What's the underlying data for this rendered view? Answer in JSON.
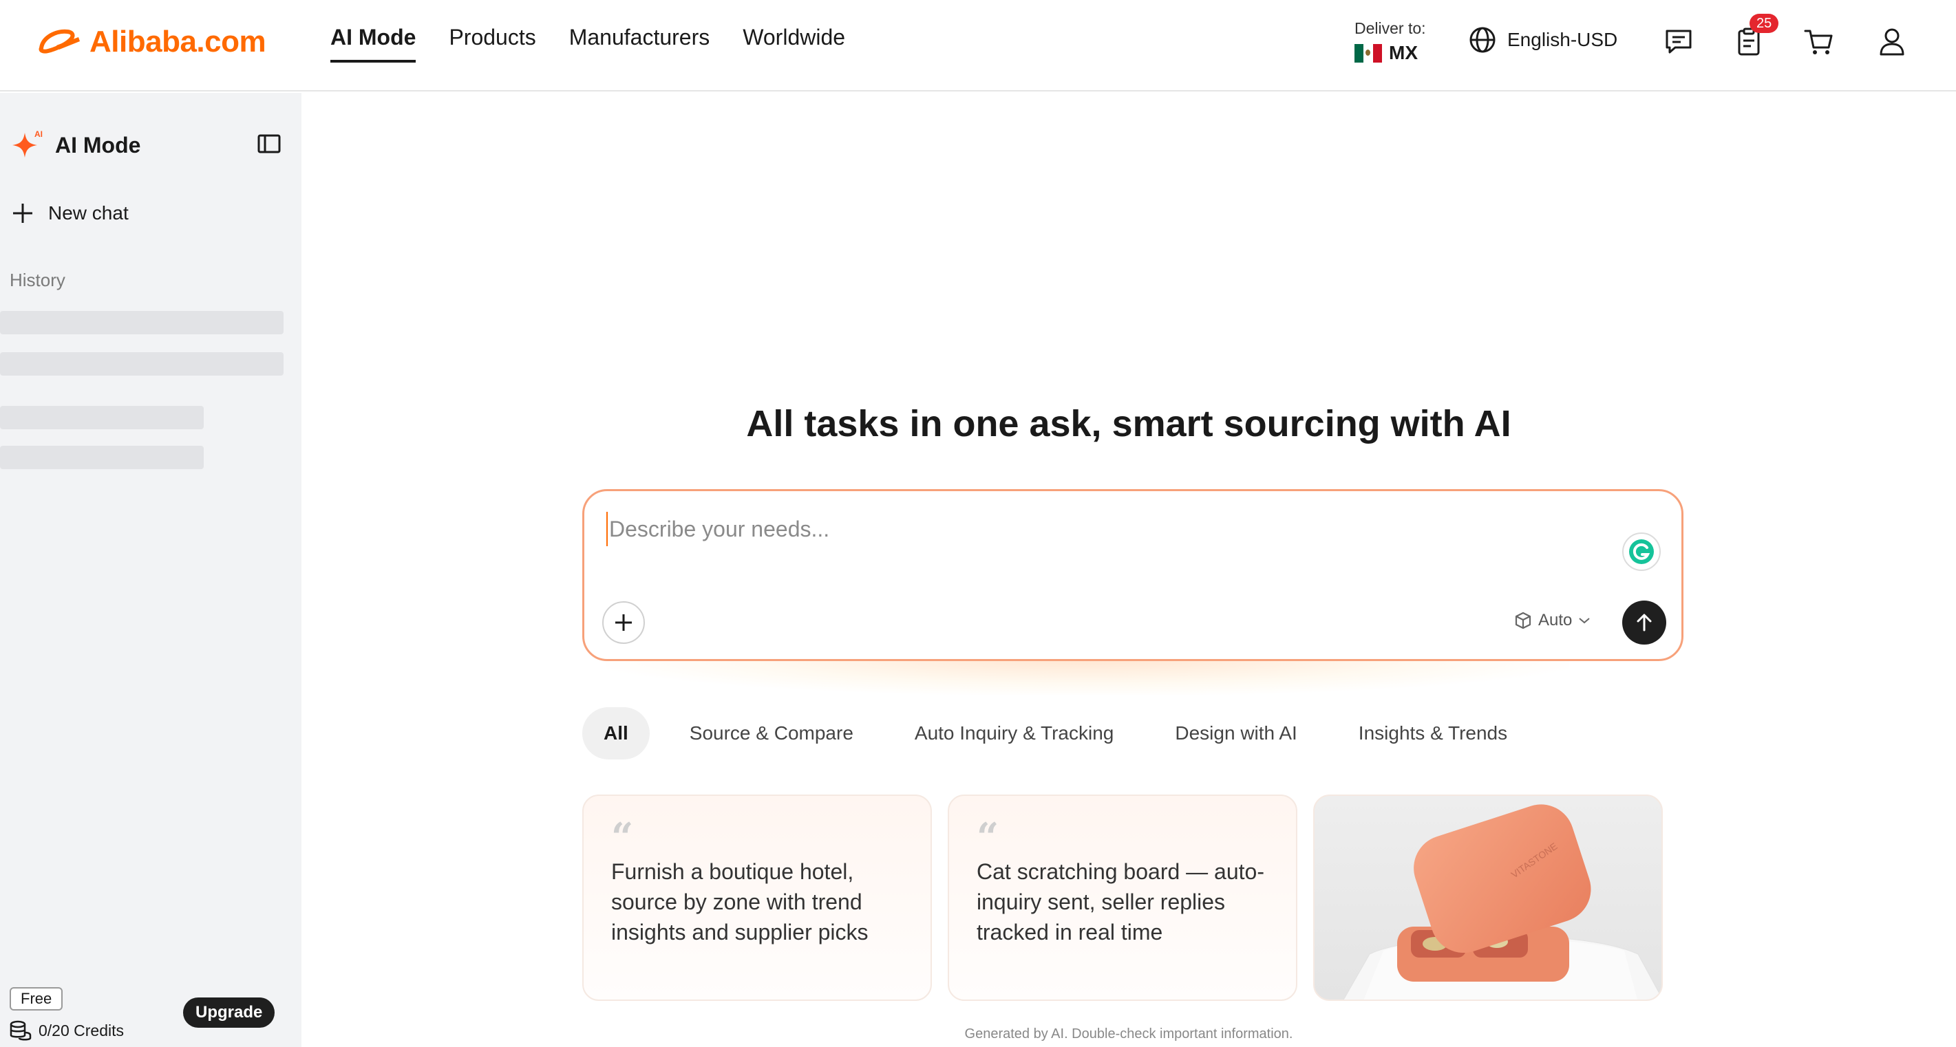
{
  "header": {
    "logo_text": "Alibaba.com",
    "nav": [
      {
        "label": "AI Mode",
        "active": true
      },
      {
        "label": "Products",
        "active": false
      },
      {
        "label": "Manufacturers",
        "active": false
      },
      {
        "label": "Worldwide",
        "active": false
      }
    ],
    "deliver_label": "Deliver to:",
    "deliver_country": "MX",
    "language": "English-USD",
    "orders_badge": "25",
    "icons": [
      "globe-icon",
      "message-icon",
      "orders-icon",
      "cart-icon",
      "user-icon"
    ]
  },
  "sidebar": {
    "title": "AI Mode",
    "title_badge": "AI",
    "new_chat": "New chat",
    "history_label": "History",
    "plan": "Free",
    "credits": "0/20 Credits",
    "upgrade": "Upgrade"
  },
  "main": {
    "headline": "All tasks in one ask, smart sourcing with AI",
    "prompt_placeholder": "Describe your needs...",
    "model_label": "Auto",
    "tabs": [
      "All",
      "Source & Compare",
      "Auto Inquiry & Tracking",
      "Design with AI",
      "Insights & Trends"
    ],
    "cards": [
      {
        "text": "Furnish a boutique hotel, source by zone with trend insights and supplier picks"
      },
      {
        "text": "Cat scratching board — auto-inquiry sent, seller replies tracked in real time"
      }
    ],
    "product_brand": "VITASTONE",
    "disclaimer": "Generated by AI. Double-check important information."
  },
  "colors": {
    "brand": "#ff6a00",
    "badge": "#e4262e",
    "prompt_border": "#f7a17a",
    "sidebar_bg": "#f2f3f5"
  }
}
